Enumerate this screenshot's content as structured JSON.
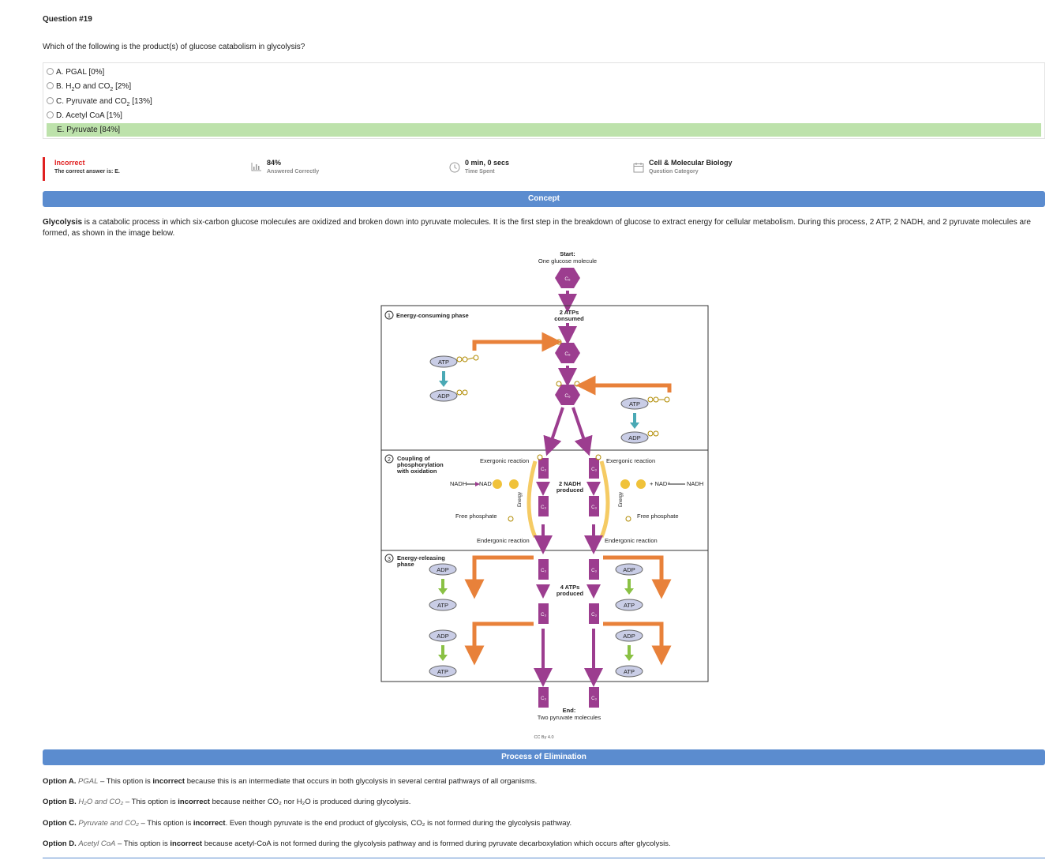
{
  "question": {
    "title": "Question #19",
    "text": "Which of the following is the product(s) of glucose catabolism in glycolysis?"
  },
  "options": [
    {
      "letter": "A.",
      "pre": "PGAL",
      "sub": "",
      "post": "",
      "pct": "[0%]"
    },
    {
      "letter": "B.",
      "pre": "H",
      "sub": "2",
      "post": "O and CO",
      "sub2": "2",
      "pct": "[2%]"
    },
    {
      "letter": "C.",
      "pre": "Pyruvate and CO",
      "sub": "2",
      "post": "",
      "pct": "[13%]"
    },
    {
      "letter": "D.",
      "pre": "Acetyl CoA",
      "sub": "",
      "post": "",
      "pct": "[1%]"
    },
    {
      "letter": "E.",
      "pre": "Pyruvate",
      "sub": "",
      "post": "",
      "pct": "[84%]"
    }
  ],
  "status": {
    "result": "Incorrect",
    "correct_answer": "The correct answer is: E.",
    "pct_correct": "84%",
    "pct_correct_label": "Answered Correctly",
    "time": "0 min, 0 secs",
    "time_label": "Time Spent",
    "category": "Cell & Molecular Biology",
    "category_label": "Question Category"
  },
  "concept": {
    "heading": "Concept",
    "bold_term": "Glycolysis",
    "paragraph": " is a catabolic process in which six-carbon glucose molecules are oxidized and broken down into pyruvate molecules. It is the first step in the breakdown of glucose to extract energy for cellular metabolism. During this process, 2 ATP, 2 NADH, and 2 pyruvate molecules are formed, as shown in the image below."
  },
  "diagram": {
    "start": "Start:",
    "start_sub": "One glucose molecule",
    "c6": "C₆",
    "c3": "C₃",
    "phase1": "Energy-consuming phase",
    "atps_consumed": "2 ATPs",
    "consumed": "consumed",
    "atp": "ATP",
    "adp": "ADP",
    "phase2_l1": "Coupling of",
    "phase2_l2": "phosphorylation",
    "phase2_l3": "with oxidation",
    "exergonic": "Exergonic reaction",
    "endergonic": "Endergonic reaction",
    "nadh_left": "NADH",
    "nad_left": "NAD⁺ +",
    "nad_right": "+ NAD⁺",
    "nadh_right": "NADH",
    "nadh_produced": "2 NADH",
    "produced": "produced",
    "free_phosphate": "Free phosphate",
    "energy": "Energy",
    "phase3_l1": "Energy-releasing",
    "phase3_l2": "phase",
    "atps_produced": "4 ATPs",
    "end": "End:",
    "end_sub": "Two pyruvate molecules",
    "license": "CC By 4.0",
    "n1": "1",
    "n2": "2",
    "n3": "3",
    "colors": {
      "hex": "#9c3d8f",
      "arrow": "#9c3d8f",
      "orange": "#e8813a",
      "teal": "#4aa9b5",
      "green": "#8ac144",
      "pill": "#c9cde6"
    }
  },
  "elimination": {
    "heading": "Process of Elimination",
    "items": [
      {
        "label": "Option A.",
        "name": "PGAL",
        "text1": " – This option is ",
        "bold": "incorrect",
        "text2": " because this is an intermediate that occurs in both glycolysis in several central pathways of all organisms."
      },
      {
        "label": "Option B.",
        "name": "H₂O and CO₂",
        "text1": " – This option is ",
        "bold": "incorrect",
        "text2": " because neither CO₂ nor H₂O is produced during glycolysis."
      },
      {
        "label": "Option C.",
        "name": "Pyruvate and CO₂",
        "text1": " – This option is ",
        "bold": "incorrect",
        "text2": ". Even though pyruvate is the end product of glycolysis, CO₂ is not formed during the glycolysis pathway."
      },
      {
        "label": "Option D.",
        "name": "Acetyl CoA",
        "text1": " – This option is ",
        "bold": "incorrect",
        "text2": " because acetyl-CoA is not formed during the glycolysis pathway and is formed during pyruvate decarboxylation which occurs after glycolysis."
      }
    ]
  }
}
